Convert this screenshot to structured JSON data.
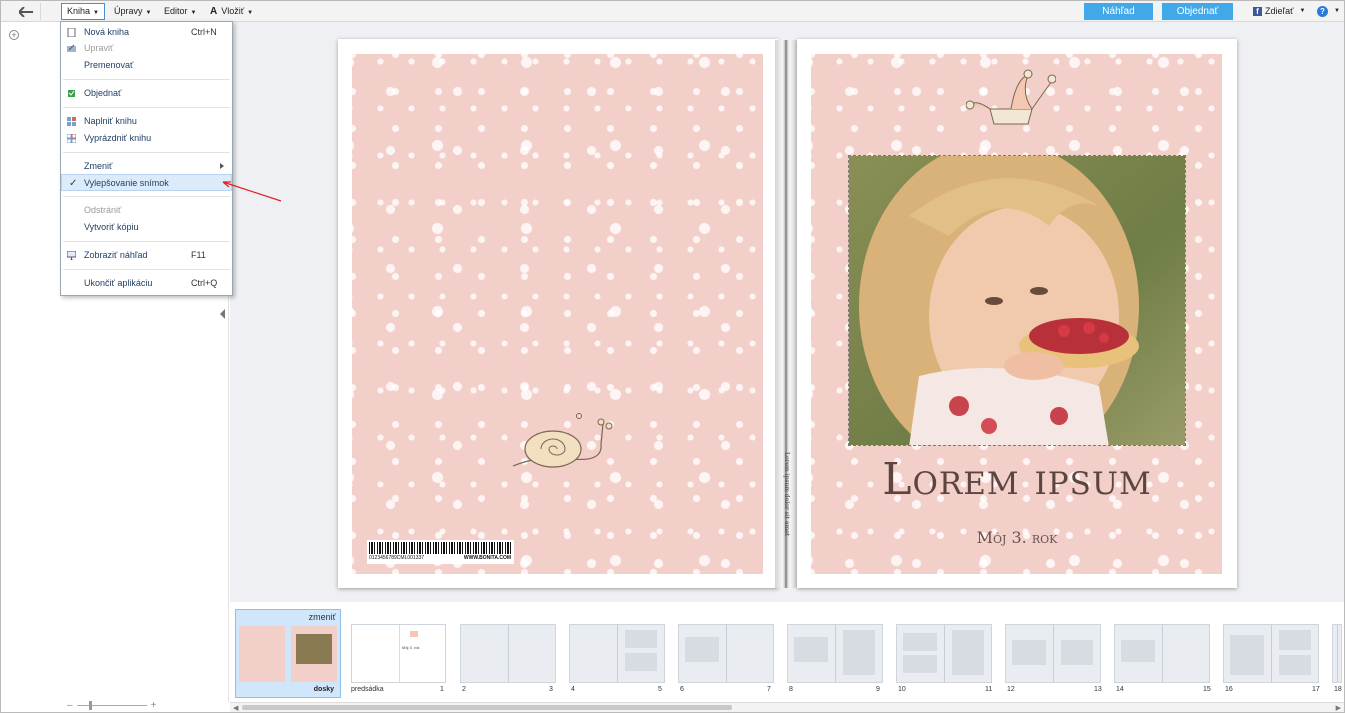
{
  "topbar": {
    "menus": [
      {
        "label": "Kniha"
      },
      {
        "label": "Úpravy"
      },
      {
        "label": "Editor"
      },
      {
        "label": "Vložiť"
      }
    ],
    "preview_button": "Náhľad",
    "order_button": "Objednať",
    "share_label": "Zdieľať",
    "help_symbol": "?"
  },
  "dropdown": {
    "items": [
      {
        "label": "Nová kniha",
        "shortcut": "Ctrl+N",
        "icon": "new-book-icon"
      },
      {
        "label": "Upraviť",
        "shortcut": "",
        "icon": "edit-icon",
        "disabled": true
      },
      {
        "label": "Premenovať",
        "shortcut": ""
      },
      {
        "label": "Objednať",
        "shortcut": "",
        "icon": "order-icon"
      },
      {
        "label": "Naplniť knihu",
        "shortcut": "",
        "icon": "fill-book-icon"
      },
      {
        "label": "Vyprázdniť knihu",
        "shortcut": "",
        "icon": "empty-book-icon"
      },
      {
        "label": "Zmeniť",
        "shortcut": ""
      },
      {
        "label": "Vylepšovanie snímok",
        "shortcut": "",
        "checked": true
      },
      {
        "label": "Odstrániť",
        "shortcut": "",
        "disabled": true
      },
      {
        "label": "Vytvoriť kópiu",
        "shortcut": ""
      },
      {
        "label": "Zobraziť náhľad",
        "shortcut": "F11",
        "icon": "preview-icon"
      },
      {
        "label": "Ukončiť aplikáciu",
        "shortcut": "Ctrl+Q"
      }
    ]
  },
  "cover": {
    "title": "Lorem ipsum",
    "subtitle": "Môj 3. rok",
    "spine_text": "Lorem ipsum dolor sit amet",
    "barcode_number": "0123456789CML001337",
    "barcode_url": "WWW.BONITA.COM"
  },
  "thumbnails": {
    "cover_change": "zmeniť",
    "cover_label": "dosky",
    "pred_label": "predsádka",
    "pred_title": "Môj 3. rok",
    "page_numbers": [
      "1",
      "2",
      "3",
      "4",
      "5",
      "6",
      "7",
      "8",
      "9",
      "10",
      "11",
      "12",
      "13",
      "14",
      "15",
      "16",
      "17",
      "18"
    ]
  },
  "colors": {
    "accent": "#42a9e8",
    "cover_pink": "#f3cfca",
    "title_brown": "#5c4540",
    "annotation_red": "#e02020"
  }
}
